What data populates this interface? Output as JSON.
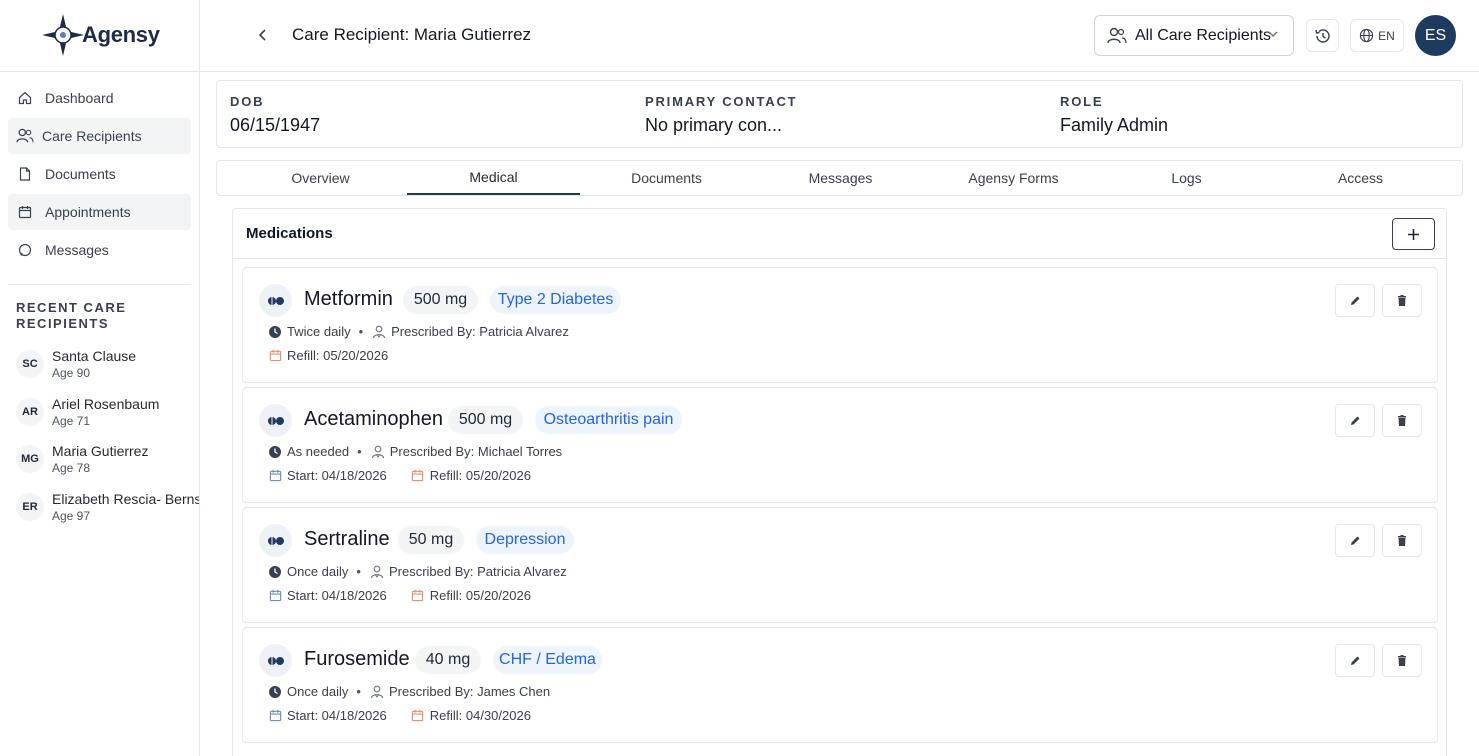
{
  "brand": {
    "name": "Agensy",
    "navy": "#1e2a4a",
    "accent_blue": "#2563eb"
  },
  "header": {
    "title": "Care Recipient: Maria Gutierrez",
    "recipient_filter": "All Care Recipients",
    "language": "EN",
    "user_initials": "ES"
  },
  "sidebar": {
    "items": [
      {
        "label": "Dashboard",
        "icon": "home-icon"
      },
      {
        "label": "Care Recipients",
        "icon": "users-icon"
      },
      {
        "label": "Documents",
        "icon": "file-icon"
      },
      {
        "label": "Appointments",
        "icon": "calendar-icon"
      },
      {
        "label": "Messages",
        "icon": "message-icon"
      }
    ],
    "recent_title": "Recent Care Recipients",
    "recent": [
      {
        "initials": "SC",
        "name": "Santa Clause",
        "age": "Age 90"
      },
      {
        "initials": "AR",
        "name": "Ariel Rosenbaum",
        "age": "Age 71"
      },
      {
        "initials": "MG",
        "name": "Maria Gutierrez",
        "age": "Age 78"
      },
      {
        "initials": "ER",
        "name": "Elizabeth Rescia- Bernstein",
        "age": "Age 97"
      }
    ]
  },
  "info": {
    "dob_label": "DOB",
    "dob_value": "06/15/1947",
    "contact_label": "Primary Contact",
    "contact_value": "No primary con...",
    "role_label": "Role",
    "role_value": "Family Admin"
  },
  "tabs": [
    "Overview",
    "Medical",
    "Documents",
    "Messages",
    "Agensy Forms",
    "Logs",
    "Access"
  ],
  "active_tab": "Medical",
  "medications": {
    "title": "Medications",
    "items": [
      {
        "name": "Metformin",
        "dose": "500 mg",
        "condition": "Type 2 Diabetes",
        "frequency": "Twice daily",
        "prescribed_by": "Prescribed By: Patricia Alvarez",
        "start": "",
        "refill": "Refill: 05/20/2026"
      },
      {
        "name": "Acetaminophen",
        "dose": "500 mg",
        "condition": "Osteoarthritis pain",
        "frequency": "As needed",
        "prescribed_by": "Prescribed By: Michael Torres",
        "start": "Start: 04/18/2026",
        "refill": "Refill: 05/20/2026"
      },
      {
        "name": "Sertraline",
        "dose": "50 mg",
        "condition": "Depression",
        "frequency": "Once daily",
        "prescribed_by": "Prescribed By: Patricia Alvarez",
        "start": "Start: 04/18/2026",
        "refill": "Refill: 05/20/2026"
      },
      {
        "name": "Furosemide",
        "dose": "40 mg",
        "condition": "CHF / Edema",
        "frequency": "Once daily",
        "prescribed_by": "Prescribed By: James Chen",
        "start": "Start: 04/18/2026",
        "refill": "Refill: 04/30/2026"
      }
    ]
  }
}
